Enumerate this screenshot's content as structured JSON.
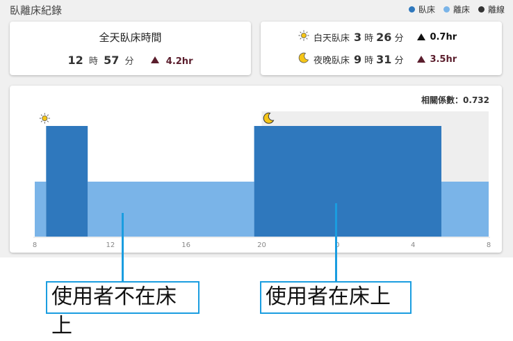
{
  "header": {
    "title": "臥離床紀錄"
  },
  "legend": [
    {
      "label": "臥床",
      "color": "#2f78bd"
    },
    {
      "label": "離床",
      "color": "#7ab4e8"
    },
    {
      "label": "離線",
      "color": "#333333"
    }
  ],
  "total_card": {
    "title": "全天臥床時間",
    "hours": "12",
    "hours_unit": "時",
    "minutes": "57",
    "minutes_unit": "分",
    "delta": "4.2hr"
  },
  "split_card": {
    "day": {
      "icon": "sun-icon",
      "label": "白天臥床",
      "hours": "3",
      "hours_unit": "時",
      "minutes": "26",
      "minutes_unit": "分",
      "delta": "0.7hr"
    },
    "night": {
      "icon": "moon-icon",
      "label": "夜晚臥床",
      "hours": "9",
      "hours_unit": "時",
      "minutes": "31",
      "minutes_unit": "分",
      "delta": "3.5hr"
    }
  },
  "correlation": "相關係數：0.732",
  "chart_data": {
    "type": "bar",
    "x_ticks": [
      "8",
      "12",
      "16",
      "20",
      "0",
      "4",
      "8"
    ],
    "series": [
      {
        "name": "臥床",
        "intervals": [
          [
            8.6,
            10.8
          ],
          [
            19.6,
            5.5
          ]
        ]
      },
      {
        "name": "離床",
        "intervals": [
          [
            8.0,
            8.6
          ],
          [
            10.8,
            19.6
          ],
          [
            5.5,
            8.0
          ]
        ]
      }
    ],
    "night_shade": [
      20,
      8
    ]
  },
  "annotations": {
    "left": "使用者不在床上",
    "right": "使用者在床上"
  }
}
